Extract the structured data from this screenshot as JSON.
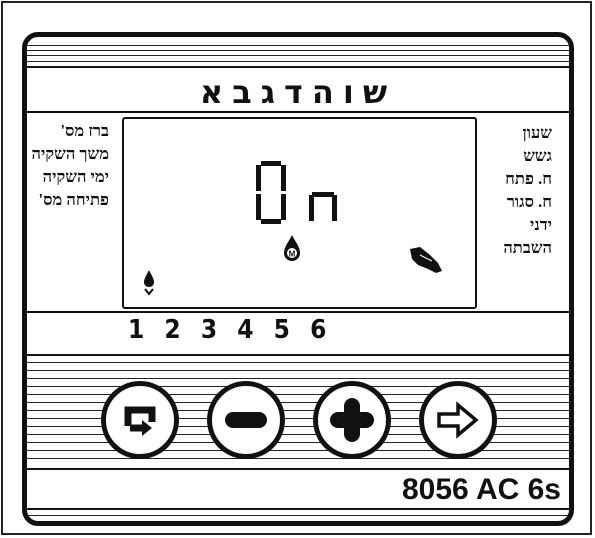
{
  "title_days": "שוהדגבא",
  "right_labels": [
    "ברז מס'",
    "משך השקיה",
    "ימי השקיה",
    "פתיחה מס'"
  ],
  "left_labels": [
    "שעון",
    "גשש",
    "ח. פתח",
    "ח. סגור",
    "ידני",
    "השבתה"
  ],
  "display": {
    "text": "On"
  },
  "station_numbers": "1 2 3 4 5 6",
  "buttons": {
    "cycle": "cycle-arrow-icon",
    "minus": "minus-icon",
    "plus": "plus-icon",
    "next": "arrow-right-icon"
  },
  "model": "8056 AC 6s"
}
